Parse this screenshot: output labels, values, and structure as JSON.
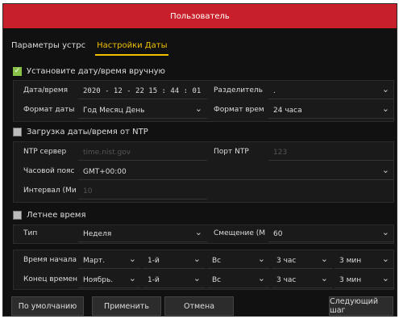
{
  "title": "Пользователь",
  "tabs": [
    {
      "label": "Параметры устрс"
    },
    {
      "label": "Настройки Даты"
    }
  ],
  "manual": {
    "label": "Установите дату/время вручную",
    "checked": true,
    "date_label": "Дата/время",
    "date_value": "2020 - 12 - 22    15 : 44 : 01",
    "separator_label": "Разделитель",
    "separator_value": ".",
    "date_format_label": "Формат даты",
    "date_format_value": "Год Месяц День",
    "time_format_label": "Формат врем",
    "time_format_value": "24 часа"
  },
  "ntp": {
    "label": "Загрузка даты/время от NTP",
    "checked": false,
    "server_label": "NTP сервер",
    "server_placeholder": "time.nist.gov",
    "port_label": "Порт NTP",
    "port_placeholder": "123",
    "timezone_label": "Часовой пояс",
    "timezone_value": "GMT+00:00",
    "interval_label": "Интервал (Ми",
    "interval_placeholder": "10"
  },
  "dst": {
    "label": "Летнее время",
    "checked": false,
    "type_label": "Тип",
    "type_value": "Неделя",
    "offset_label": "Смещение (М",
    "offset_value": "60",
    "start_label": "Время начала",
    "start": [
      "Март.",
      "1-й",
      "Вс",
      "3 час",
      "3 мин"
    ],
    "end_label": "Конец времен",
    "end": [
      "Ноябрь.",
      "1-й",
      "Вс",
      "3 час",
      "3 мин"
    ]
  },
  "buttons": {
    "default": "По умолчанию",
    "apply": "Применить",
    "cancel": "Отмена",
    "next": "Следующий шаг"
  },
  "colors": {
    "titlebar": "#c8202a",
    "active_tab": "#f0c000",
    "checkbox_checked": "#8bc34a"
  }
}
